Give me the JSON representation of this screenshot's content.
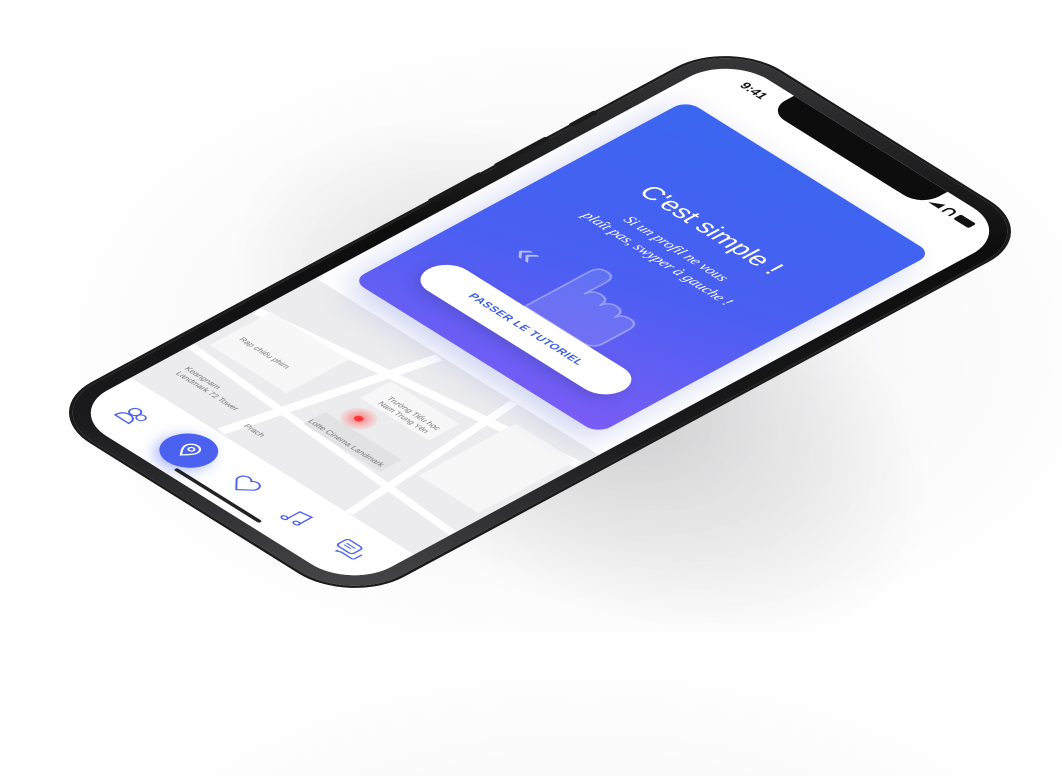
{
  "status_bar": {
    "time": "9:41"
  },
  "tutorial_card": {
    "title": "C'est simple !",
    "text_line1": "Si un profil ne vous",
    "text_line2": "plaît pas, swyper à gauche !",
    "hint_arrows": "«",
    "skip_button_label": "PASSER LE TUTORIEL"
  },
  "map": {
    "labels": [
      "Rạp chiếu phim",
      "Lotte Cinema Landmark",
      "Trường Tiểu học",
      "Nam Trung Yên",
      "Prach",
      "Keangnam",
      "Landmark 72 Tower"
    ]
  },
  "bottom_nav": {
    "items": [
      {
        "icon": "profile-icon",
        "active": false
      },
      {
        "icon": "location-pin-icon",
        "active": true
      },
      {
        "icon": "heart-icon",
        "active": false
      },
      {
        "icon": "music-icon",
        "active": false
      },
      {
        "icon": "chat-icon",
        "active": false
      }
    ]
  },
  "colors": {
    "accent": "#4a62ef",
    "card_gradient_start": "#3a66f0",
    "card_gradient_end": "#7a5cf5",
    "pin": "#ff3b3b"
  }
}
